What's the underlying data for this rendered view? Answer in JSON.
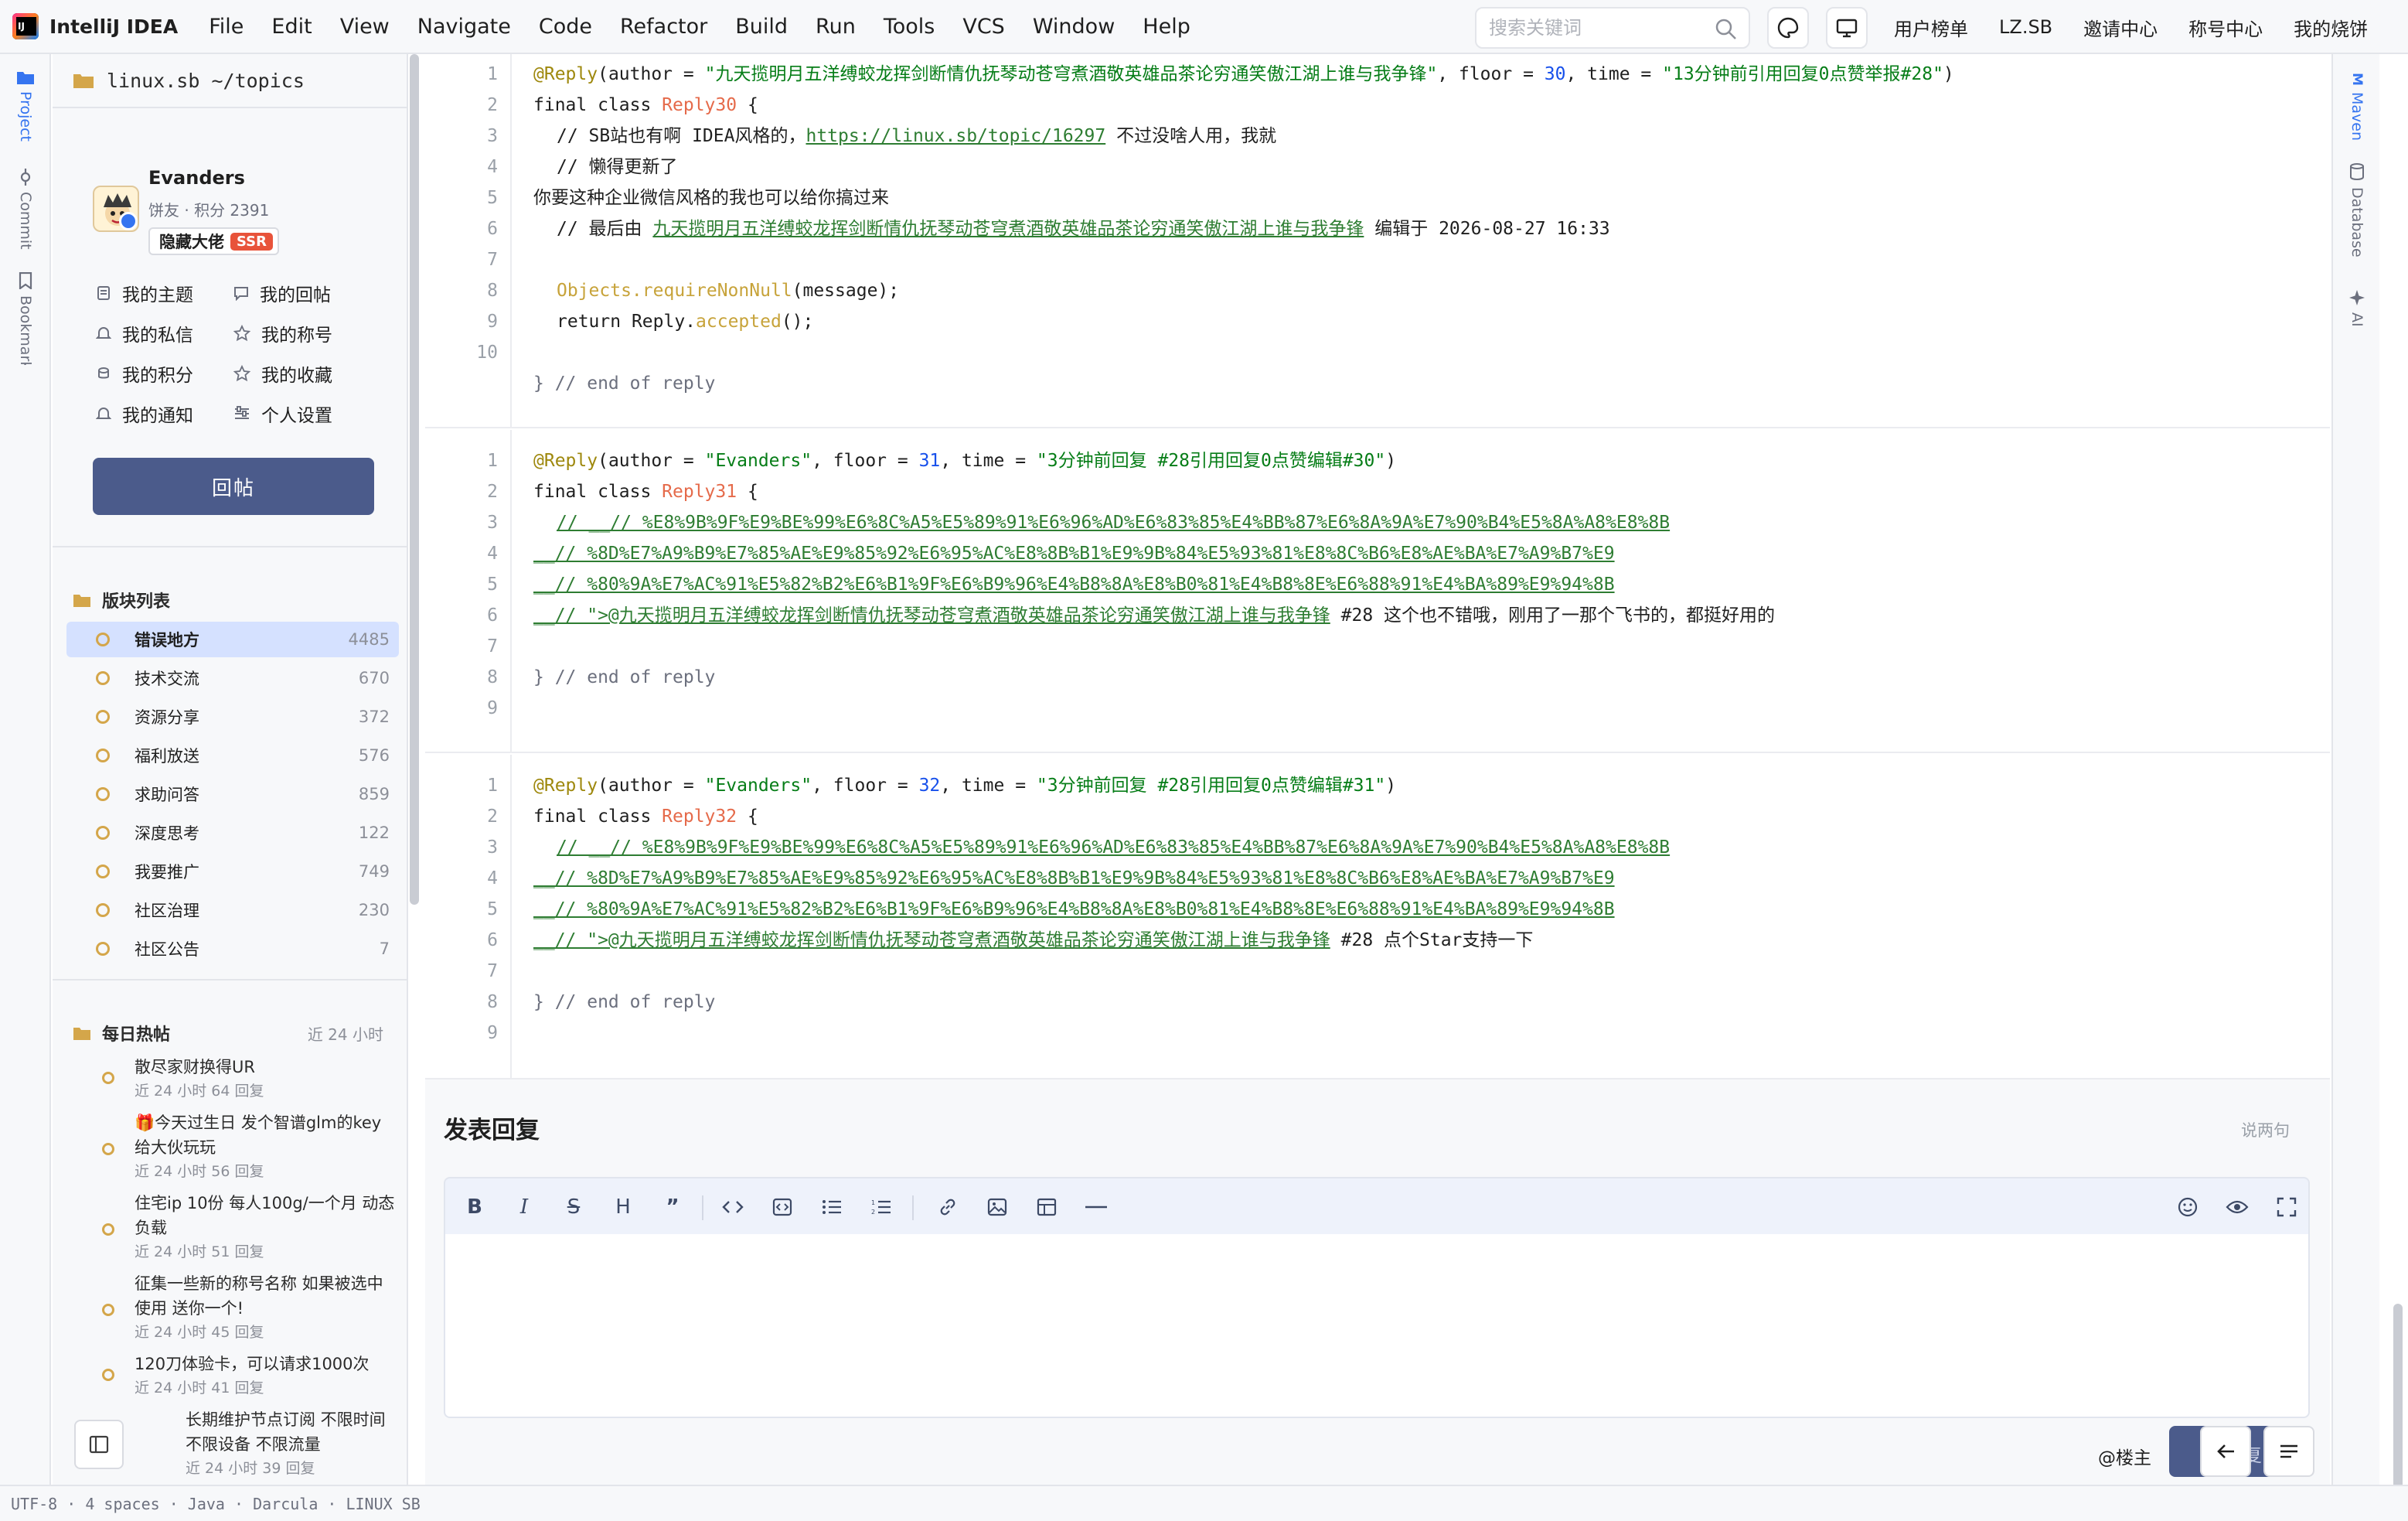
{
  "app": {
    "name": "IntelliJ IDEA",
    "accent": "#3574f0"
  },
  "menu": [
    "File",
    "Edit",
    "View",
    "Navigate",
    "Code",
    "Refactor",
    "Build",
    "Run",
    "Tools",
    "VCS",
    "Window",
    "Help"
  ],
  "search": {
    "placeholder": "搜索关键词"
  },
  "top_links": [
    "用户榜单",
    "LZ.SB",
    "邀请中心",
    "称号中心",
    "我的烧饼"
  ],
  "left_strip": [
    "Project",
    "Commit",
    "Bookmarks"
  ],
  "right_strip": [
    "Maven",
    "Database",
    "AI"
  ],
  "project": {
    "path": "linux.sb ~/topics"
  },
  "user": {
    "name": "Evanders",
    "meta": "饼友 · 积分 2391",
    "title": "隐藏大佬",
    "badge": "SSR",
    "menu": [
      "我的主题",
      "我的回帖",
      "我的私信",
      "我的称号",
      "我的积分",
      "我的收藏",
      "我的通知",
      "个人设置"
    ]
  },
  "reply_button": "回帖",
  "categories": {
    "title": "版块列表",
    "items": [
      {
        "name": "错误地方",
        "count": "4485"
      },
      {
        "name": "技术交流",
        "count": "670"
      },
      {
        "name": "资源分享",
        "count": "372"
      },
      {
        "name": "福利放送",
        "count": "576"
      },
      {
        "name": "求助问答",
        "count": "859"
      },
      {
        "name": "深度思考",
        "count": "122"
      },
      {
        "name": "我要推广",
        "count": "749"
      },
      {
        "name": "社区治理",
        "count": "230"
      },
      {
        "name": "社区公告",
        "count": "7"
      }
    ]
  },
  "hot": {
    "title": "每日热帖",
    "range": "近 24 小时",
    "items": [
      {
        "title": "散尽家财换得UR",
        "meta": "近 24 小时 64 回复"
      },
      {
        "title": "🎁今天过生日 发个智谱glm的key给大伙玩玩",
        "meta": "近 24 小时 56 回复"
      },
      {
        "title": "住宅ip 10份 每人100g/一个月 动态负载",
        "meta": "近 24 小时 51 回复"
      },
      {
        "title": "征集一些新的称号名称 如果被选中使用 送你一个!",
        "meta": "近 24 小时 45 回复"
      },
      {
        "title": "120刀体验卡，可以请求1000次",
        "meta": "近 24 小时 41 回复"
      },
      {
        "title": "长期维护节点订阅 不限时间 不限设备 不限流量",
        "meta": "近 24 小时 39 回复"
      }
    ]
  },
  "replies": [
    {
      "author": "九天揽明月五洋缚蛟龙挥剑断情仇抚琴动苍穹煮酒敬英雄品茶论穷通笑傲江湖上谁与我争锋",
      "floor": "30",
      "time": "13分钟前引用回复0点赞举报#28",
      "class_name": "Reply30",
      "c1_pre": "// SB站也有啊 IDEA风格的，",
      "c1_link": "https://linux.sb/topic/16297",
      "c1_post": " 不过没啥人用，我就",
      "c2": "// 懒得更新了",
      "c3": "你要这种企业微信风格的我也可以给你搞过来",
      "edit_pre": "// 最后由 ",
      "edit_link": "九天揽明月五洋缚蛟龙挥剑断情仇抚琴动苍穹煮酒敬英雄品茶论穷通笑傲江湖上谁与我争锋",
      "edit_post": " 编辑于 2026-08-27 16:33",
      "stmt1_method": "Objects.requireNonNull",
      "stmt1_arg": "(message);",
      "stmt2_kw": "return ",
      "stmt2_obj": "Reply.",
      "stmt2_method": "accepted",
      "stmt2_end": "();",
      "end": "} // end of reply"
    },
    {
      "author": "Evanders",
      "floor": "31",
      "time": "3分钟前回复 #28引用回复0点赞编辑#30",
      "class_name": "Reply31",
      "l1": "// __// %E8%9B%9F%E9%BE%99%E6%8C%A5%E5%89%91%E6%96%AD%E6%83%85%E4%BB%87%E6%8A%9A%E7%90%B4%E5%8A%A8%E8%8B",
      "l2": "__// %8D%E7%A9%B9%E7%85%AE%E9%85%92%E6%95%AC%E8%8B%B1%E9%9B%84%E5%93%81%E8%8C%B6%E8%AE%BA%E7%A9%B7%E9",
      "l3": "__// %80%9A%E7%AC%91%E5%82%B2%E6%B1%9F%E6%B9%96%E4%B8%8A%E8%B0%81%E4%B8%8E%E6%88%91%E4%BA%89%E9%94%8B",
      "l4_link": "__// \">@九天揽明月五洋缚蛟龙挥剑断情仇抚琴动苍穹煮酒敬英雄品茶论穷通笑傲江湖上谁与我争锋",
      "l4_text": " #28 这个也不错哦，刚用了一那个飞书的，都挺好用的",
      "end": "} // end of reply"
    },
    {
      "author": "Evanders",
      "floor": "32",
      "time": "3分钟前回复 #28引用回复0点赞编辑#31",
      "class_name": "Reply32",
      "l1": "// __// %E8%9B%9F%E9%BE%99%E6%8C%A5%E5%89%91%E6%96%AD%E6%83%85%E4%BB%87%E6%8A%9A%E7%90%B4%E5%8A%A8%E8%8B",
      "l2": "__// %8D%E7%A9%B9%E7%85%AE%E9%85%92%E6%95%AC%E8%8B%B1%E9%9B%84%E5%93%81%E8%8C%B6%E8%AE%BA%E7%A9%B7%E9",
      "l3": "__// %80%9A%E7%AC%91%E5%82%B2%E6%B1%9F%E6%B9%96%E4%B8%8A%E8%B0%81%E4%B8%8E%E6%88%91%E4%BA%89%E9%94%8B",
      "l4_link": "__// \">@九天揽明月五洋缚蛟龙挥剑断情仇抚琴动苍穹煮酒敬英雄品茶论穷通笑傲江湖上谁与我争锋",
      "l4_text": " #28 点个Star支持一下",
      "end": "} // end of reply"
    }
  ],
  "syntax": {
    "annotation": "@Reply",
    "author_key": "(author = ",
    "floor_key": ", floor = ",
    "time_key": ", time = ",
    "close_paren": ")",
    "final_class": "final class ",
    "brace_open": " {"
  },
  "composer": {
    "title": "发表回复",
    "hint": "说两句",
    "toolbar": [
      "bold",
      "italic",
      "strikethrough",
      "heading",
      "quote",
      "code",
      "code-block",
      "bullet-list",
      "ordered-list",
      "link",
      "image",
      "table",
      "horizontal-rule",
      "emoji",
      "preview",
      "fullscreen"
    ],
    "mention": "@楼主",
    "submit_partial": "复"
  },
  "status_bar": "UTF-8 · 4 spaces · Java · Darcula · LINUX SB"
}
